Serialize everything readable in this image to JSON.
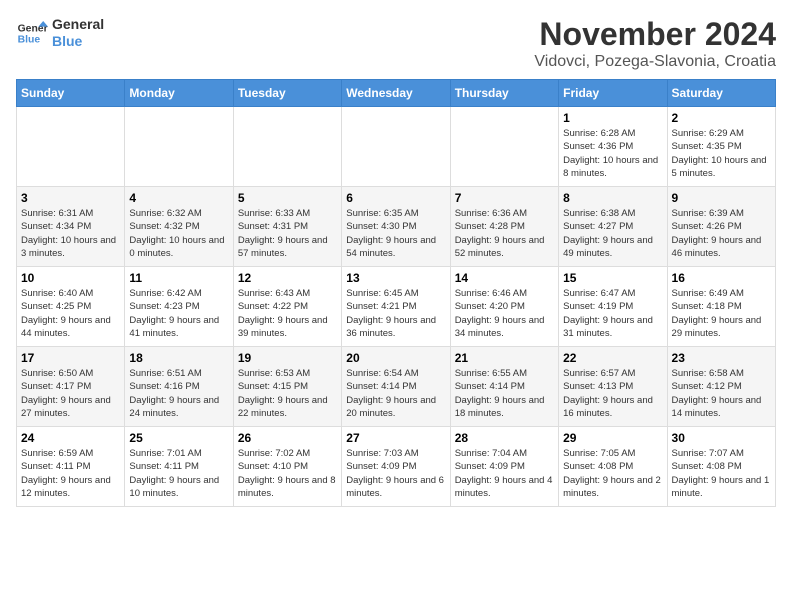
{
  "logo": {
    "line1": "General",
    "line2": "Blue"
  },
  "title": "November 2024",
  "location": "Vidovci, Pozega-Slavonia, Croatia",
  "days_of_week": [
    "Sunday",
    "Monday",
    "Tuesday",
    "Wednesday",
    "Thursday",
    "Friday",
    "Saturday"
  ],
  "weeks": [
    [
      {
        "day": "",
        "info": ""
      },
      {
        "day": "",
        "info": ""
      },
      {
        "day": "",
        "info": ""
      },
      {
        "day": "",
        "info": ""
      },
      {
        "day": "",
        "info": ""
      },
      {
        "day": "1",
        "info": "Sunrise: 6:28 AM\nSunset: 4:36 PM\nDaylight: 10 hours and 8 minutes."
      },
      {
        "day": "2",
        "info": "Sunrise: 6:29 AM\nSunset: 4:35 PM\nDaylight: 10 hours and 5 minutes."
      }
    ],
    [
      {
        "day": "3",
        "info": "Sunrise: 6:31 AM\nSunset: 4:34 PM\nDaylight: 10 hours and 3 minutes."
      },
      {
        "day": "4",
        "info": "Sunrise: 6:32 AM\nSunset: 4:32 PM\nDaylight: 10 hours and 0 minutes."
      },
      {
        "day": "5",
        "info": "Sunrise: 6:33 AM\nSunset: 4:31 PM\nDaylight: 9 hours and 57 minutes."
      },
      {
        "day": "6",
        "info": "Sunrise: 6:35 AM\nSunset: 4:30 PM\nDaylight: 9 hours and 54 minutes."
      },
      {
        "day": "7",
        "info": "Sunrise: 6:36 AM\nSunset: 4:28 PM\nDaylight: 9 hours and 52 minutes."
      },
      {
        "day": "8",
        "info": "Sunrise: 6:38 AM\nSunset: 4:27 PM\nDaylight: 9 hours and 49 minutes."
      },
      {
        "day": "9",
        "info": "Sunrise: 6:39 AM\nSunset: 4:26 PM\nDaylight: 9 hours and 46 minutes."
      }
    ],
    [
      {
        "day": "10",
        "info": "Sunrise: 6:40 AM\nSunset: 4:25 PM\nDaylight: 9 hours and 44 minutes."
      },
      {
        "day": "11",
        "info": "Sunrise: 6:42 AM\nSunset: 4:23 PM\nDaylight: 9 hours and 41 minutes."
      },
      {
        "day": "12",
        "info": "Sunrise: 6:43 AM\nSunset: 4:22 PM\nDaylight: 9 hours and 39 minutes."
      },
      {
        "day": "13",
        "info": "Sunrise: 6:45 AM\nSunset: 4:21 PM\nDaylight: 9 hours and 36 minutes."
      },
      {
        "day": "14",
        "info": "Sunrise: 6:46 AM\nSunset: 4:20 PM\nDaylight: 9 hours and 34 minutes."
      },
      {
        "day": "15",
        "info": "Sunrise: 6:47 AM\nSunset: 4:19 PM\nDaylight: 9 hours and 31 minutes."
      },
      {
        "day": "16",
        "info": "Sunrise: 6:49 AM\nSunset: 4:18 PM\nDaylight: 9 hours and 29 minutes."
      }
    ],
    [
      {
        "day": "17",
        "info": "Sunrise: 6:50 AM\nSunset: 4:17 PM\nDaylight: 9 hours and 27 minutes."
      },
      {
        "day": "18",
        "info": "Sunrise: 6:51 AM\nSunset: 4:16 PM\nDaylight: 9 hours and 24 minutes."
      },
      {
        "day": "19",
        "info": "Sunrise: 6:53 AM\nSunset: 4:15 PM\nDaylight: 9 hours and 22 minutes."
      },
      {
        "day": "20",
        "info": "Sunrise: 6:54 AM\nSunset: 4:14 PM\nDaylight: 9 hours and 20 minutes."
      },
      {
        "day": "21",
        "info": "Sunrise: 6:55 AM\nSunset: 4:14 PM\nDaylight: 9 hours and 18 minutes."
      },
      {
        "day": "22",
        "info": "Sunrise: 6:57 AM\nSunset: 4:13 PM\nDaylight: 9 hours and 16 minutes."
      },
      {
        "day": "23",
        "info": "Sunrise: 6:58 AM\nSunset: 4:12 PM\nDaylight: 9 hours and 14 minutes."
      }
    ],
    [
      {
        "day": "24",
        "info": "Sunrise: 6:59 AM\nSunset: 4:11 PM\nDaylight: 9 hours and 12 minutes."
      },
      {
        "day": "25",
        "info": "Sunrise: 7:01 AM\nSunset: 4:11 PM\nDaylight: 9 hours and 10 minutes."
      },
      {
        "day": "26",
        "info": "Sunrise: 7:02 AM\nSunset: 4:10 PM\nDaylight: 9 hours and 8 minutes."
      },
      {
        "day": "27",
        "info": "Sunrise: 7:03 AM\nSunset: 4:09 PM\nDaylight: 9 hours and 6 minutes."
      },
      {
        "day": "28",
        "info": "Sunrise: 7:04 AM\nSunset: 4:09 PM\nDaylight: 9 hours and 4 minutes."
      },
      {
        "day": "29",
        "info": "Sunrise: 7:05 AM\nSunset: 4:08 PM\nDaylight: 9 hours and 2 minutes."
      },
      {
        "day": "30",
        "info": "Sunrise: 7:07 AM\nSunset: 4:08 PM\nDaylight: 9 hours and 1 minute."
      }
    ]
  ]
}
